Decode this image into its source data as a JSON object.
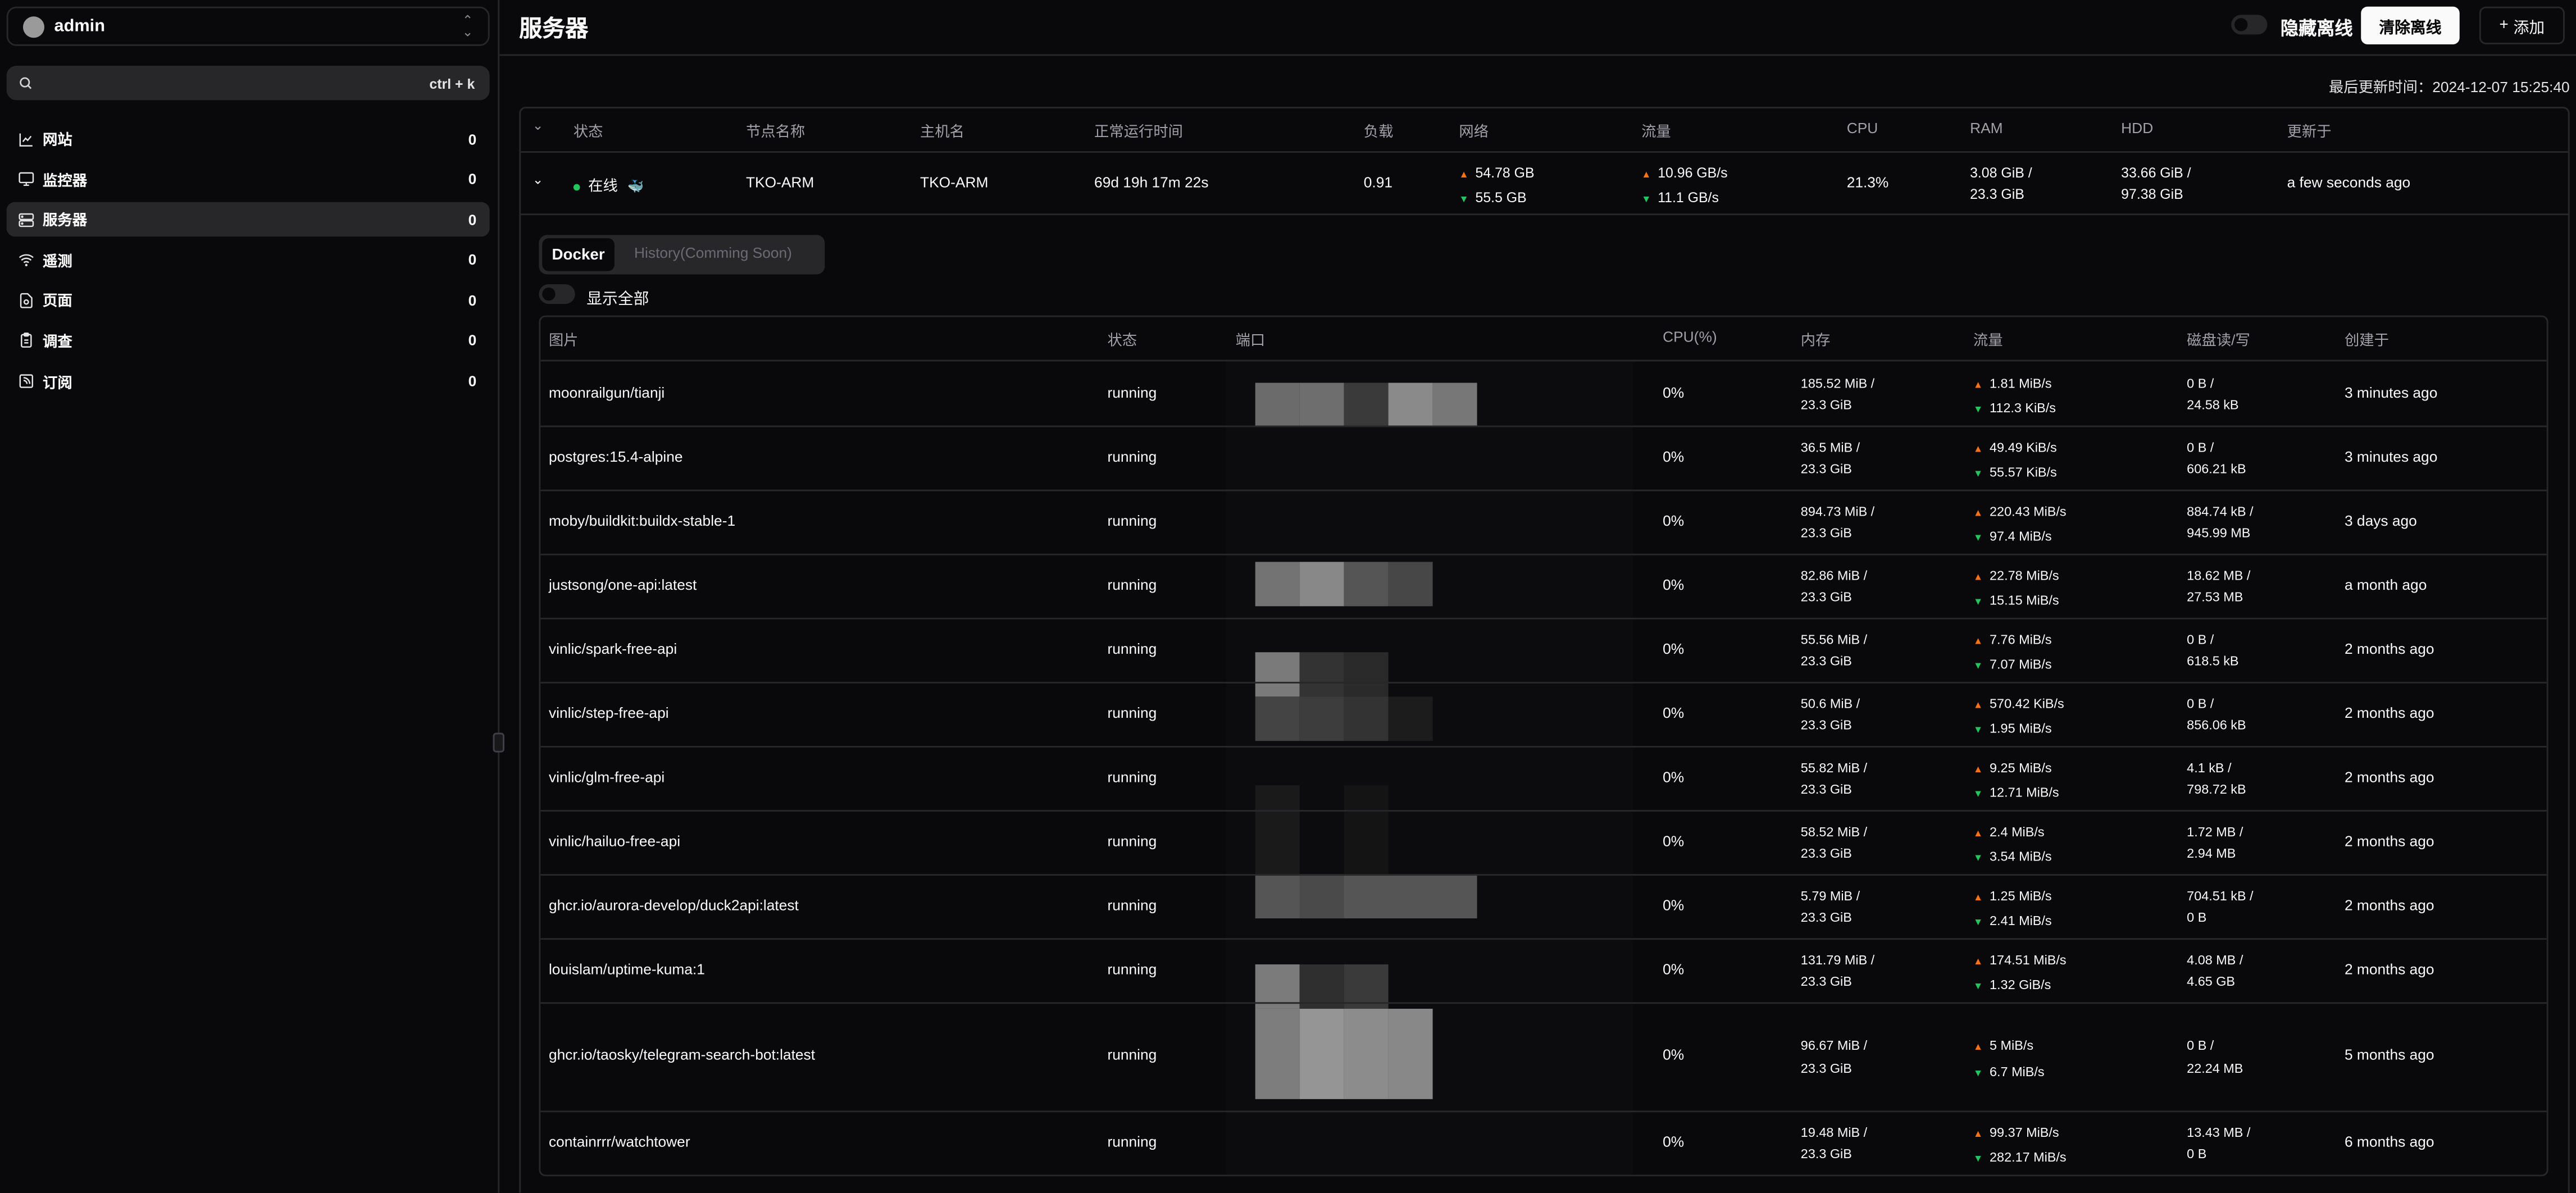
{
  "user": {
    "name": "admin"
  },
  "search": {
    "placeholder": "",
    "shortcut": "ctrl + k"
  },
  "nav": [
    {
      "label": "网站",
      "count": "0",
      "icon": "chart-icon"
    },
    {
      "label": "监控器",
      "count": "0",
      "icon": "monitor-icon"
    },
    {
      "label": "服务器",
      "count": "0",
      "icon": "server-icon",
      "active": true
    },
    {
      "label": "遥测",
      "count": "0",
      "icon": "wifi-icon"
    },
    {
      "label": "页面",
      "count": "0",
      "icon": "file-icon"
    },
    {
      "label": "调查",
      "count": "0",
      "icon": "clipboard-icon"
    },
    {
      "label": "订阅",
      "count": "0",
      "icon": "rss-icon"
    }
  ],
  "header": {
    "title": "服务器",
    "hide_offline": "隐藏离线",
    "clear_offline": "清除离线",
    "add": "添加"
  },
  "last_updated": "最后更新时间：2024-12-07 15:25:40",
  "server_table": {
    "headers": [
      "状态",
      "节点名称",
      "主机名",
      "正常运行时间",
      "负载",
      "网络",
      "流量",
      "CPU",
      "RAM",
      "HDD",
      "更新于"
    ],
    "row": {
      "status": "在线",
      "node": "TKO-ARM",
      "host": "TKO-ARM",
      "uptime": "69d 19h 17m 22s",
      "load": "0.91",
      "net_up": "54.78 GB",
      "net_down": "55.5 GB",
      "traffic_up": "10.96 GB/s",
      "traffic_down": "11.1 GB/s",
      "cpu": "21.3%",
      "ram_1": "3.08 GiB /",
      "ram_2": "23.3 GiB",
      "hdd_1": "33.66 GiB /",
      "hdd_2": "97.38 GiB",
      "updated": "a few seconds ago"
    }
  },
  "tabs": {
    "docker": "Docker",
    "history": "History(Comming Soon)"
  },
  "show_all": "显示全部",
  "docker": {
    "headers": [
      "图片",
      "状态",
      "端口",
      "CPU(%)",
      "内存",
      "流量",
      "磁盘读/写",
      "创建于"
    ],
    "rows": [
      {
        "image": "moonrailgun/tianji",
        "status": "running",
        "cpu": "0%",
        "mem1": "185.52 MiB /",
        "mem2": "23.3 GiB",
        "up": "1.81 MiB/s",
        "down": "112.3 KiB/s",
        "disk1": "0 B /",
        "disk2": "24.58 kB",
        "created": "3 minutes ago"
      },
      {
        "image": "postgres:15.4-alpine",
        "status": "running",
        "cpu": "0%",
        "mem1": "36.5 MiB /",
        "mem2": "23.3 GiB",
        "up": "49.49 KiB/s",
        "down": "55.57 KiB/s",
        "disk1": "0 B /",
        "disk2": "606.21 kB",
        "created": "3 minutes ago"
      },
      {
        "image": "moby/buildkit:buildx-stable-1",
        "status": "running",
        "cpu": "0%",
        "mem1": "894.73 MiB /",
        "mem2": "23.3 GiB",
        "up": "220.43 MiB/s",
        "down": "97.4 MiB/s",
        "disk1": "884.74 kB /",
        "disk2": "945.99 MB",
        "created": "3 days ago"
      },
      {
        "image": "justsong/one-api:latest",
        "status": "running",
        "cpu": "0%",
        "mem1": "82.86 MiB /",
        "mem2": "23.3 GiB",
        "up": "22.78 MiB/s",
        "down": "15.15 MiB/s",
        "disk1": "18.62 MB /",
        "disk2": "27.53 MB",
        "created": "a month ago"
      },
      {
        "image": "vinlic/spark-free-api",
        "status": "running",
        "cpu": "0%",
        "mem1": "55.56 MiB /",
        "mem2": "23.3 GiB",
        "up": "7.76 MiB/s",
        "down": "7.07 MiB/s",
        "disk1": "0 B /",
        "disk2": "618.5 kB",
        "created": "2 months ago"
      },
      {
        "image": "vinlic/step-free-api",
        "status": "running",
        "cpu": "0%",
        "mem1": "50.6 MiB /",
        "mem2": "23.3 GiB",
        "up": "570.42 KiB/s",
        "down": "1.95 MiB/s",
        "disk1": "0 B /",
        "disk2": "856.06 kB",
        "created": "2 months ago"
      },
      {
        "image": "vinlic/glm-free-api",
        "status": "running",
        "cpu": "0%",
        "mem1": "55.82 MiB /",
        "mem2": "23.3 GiB",
        "up": "9.25 MiB/s",
        "down": "12.71 MiB/s",
        "disk1": "4.1 kB /",
        "disk2": "798.72 kB",
        "created": "2 months ago"
      },
      {
        "image": "vinlic/hailuo-free-api",
        "status": "running",
        "cpu": "0%",
        "mem1": "58.52 MiB /",
        "mem2": "23.3 GiB",
        "up": "2.4 MiB/s",
        "down": "3.54 MiB/s",
        "disk1": "1.72 MB /",
        "disk2": "2.94 MB",
        "created": "2 months ago"
      },
      {
        "image": "ghcr.io/aurora-develop/duck2api:latest",
        "status": "running",
        "cpu": "0%",
        "mem1": "5.79 MiB /",
        "mem2": "23.3 GiB",
        "up": "1.25 MiB/s",
        "down": "2.41 MiB/s",
        "disk1": "704.51 kB /",
        "disk2": "0 B",
        "created": "2 months ago"
      },
      {
        "image": "louislam/uptime-kuma:1",
        "status": "running",
        "cpu": "0%",
        "mem1": "131.79 MiB /",
        "mem2": "23.3 GiB",
        "up": "174.51 MiB/s",
        "down": "1.32 GiB/s",
        "disk1": "4.08 MB /",
        "disk2": "4.65 GB",
        "created": "2 months ago"
      },
      {
        "image": "ghcr.io/taosky/telegram-search-bot:latest",
        "status": "running",
        "cpu": "0%",
        "mem1": "96.67 MiB /",
        "mem2": "23.3 GiB",
        "up": "5 MiB/s",
        "down": "6.7 MiB/s",
        "disk1": "0 B /",
        "disk2": "22.24 MB",
        "created": "5 months ago"
      },
      {
        "image": "containrrr/watchtower",
        "status": "running",
        "cpu": "0%",
        "mem1": "19.48 MiB /",
        "mem2": "23.3 GiB",
        "up": "99.37 MiB/s",
        "down": "282.17 MiB/s",
        "disk1": "13.43 MB /",
        "disk2": "0 B",
        "created": "6 months ago"
      }
    ]
  },
  "colors": {
    "background": "#09090b",
    "border": "#27272a",
    "up": "#f97316",
    "down": "#22c55e",
    "online": "#22c55e"
  }
}
